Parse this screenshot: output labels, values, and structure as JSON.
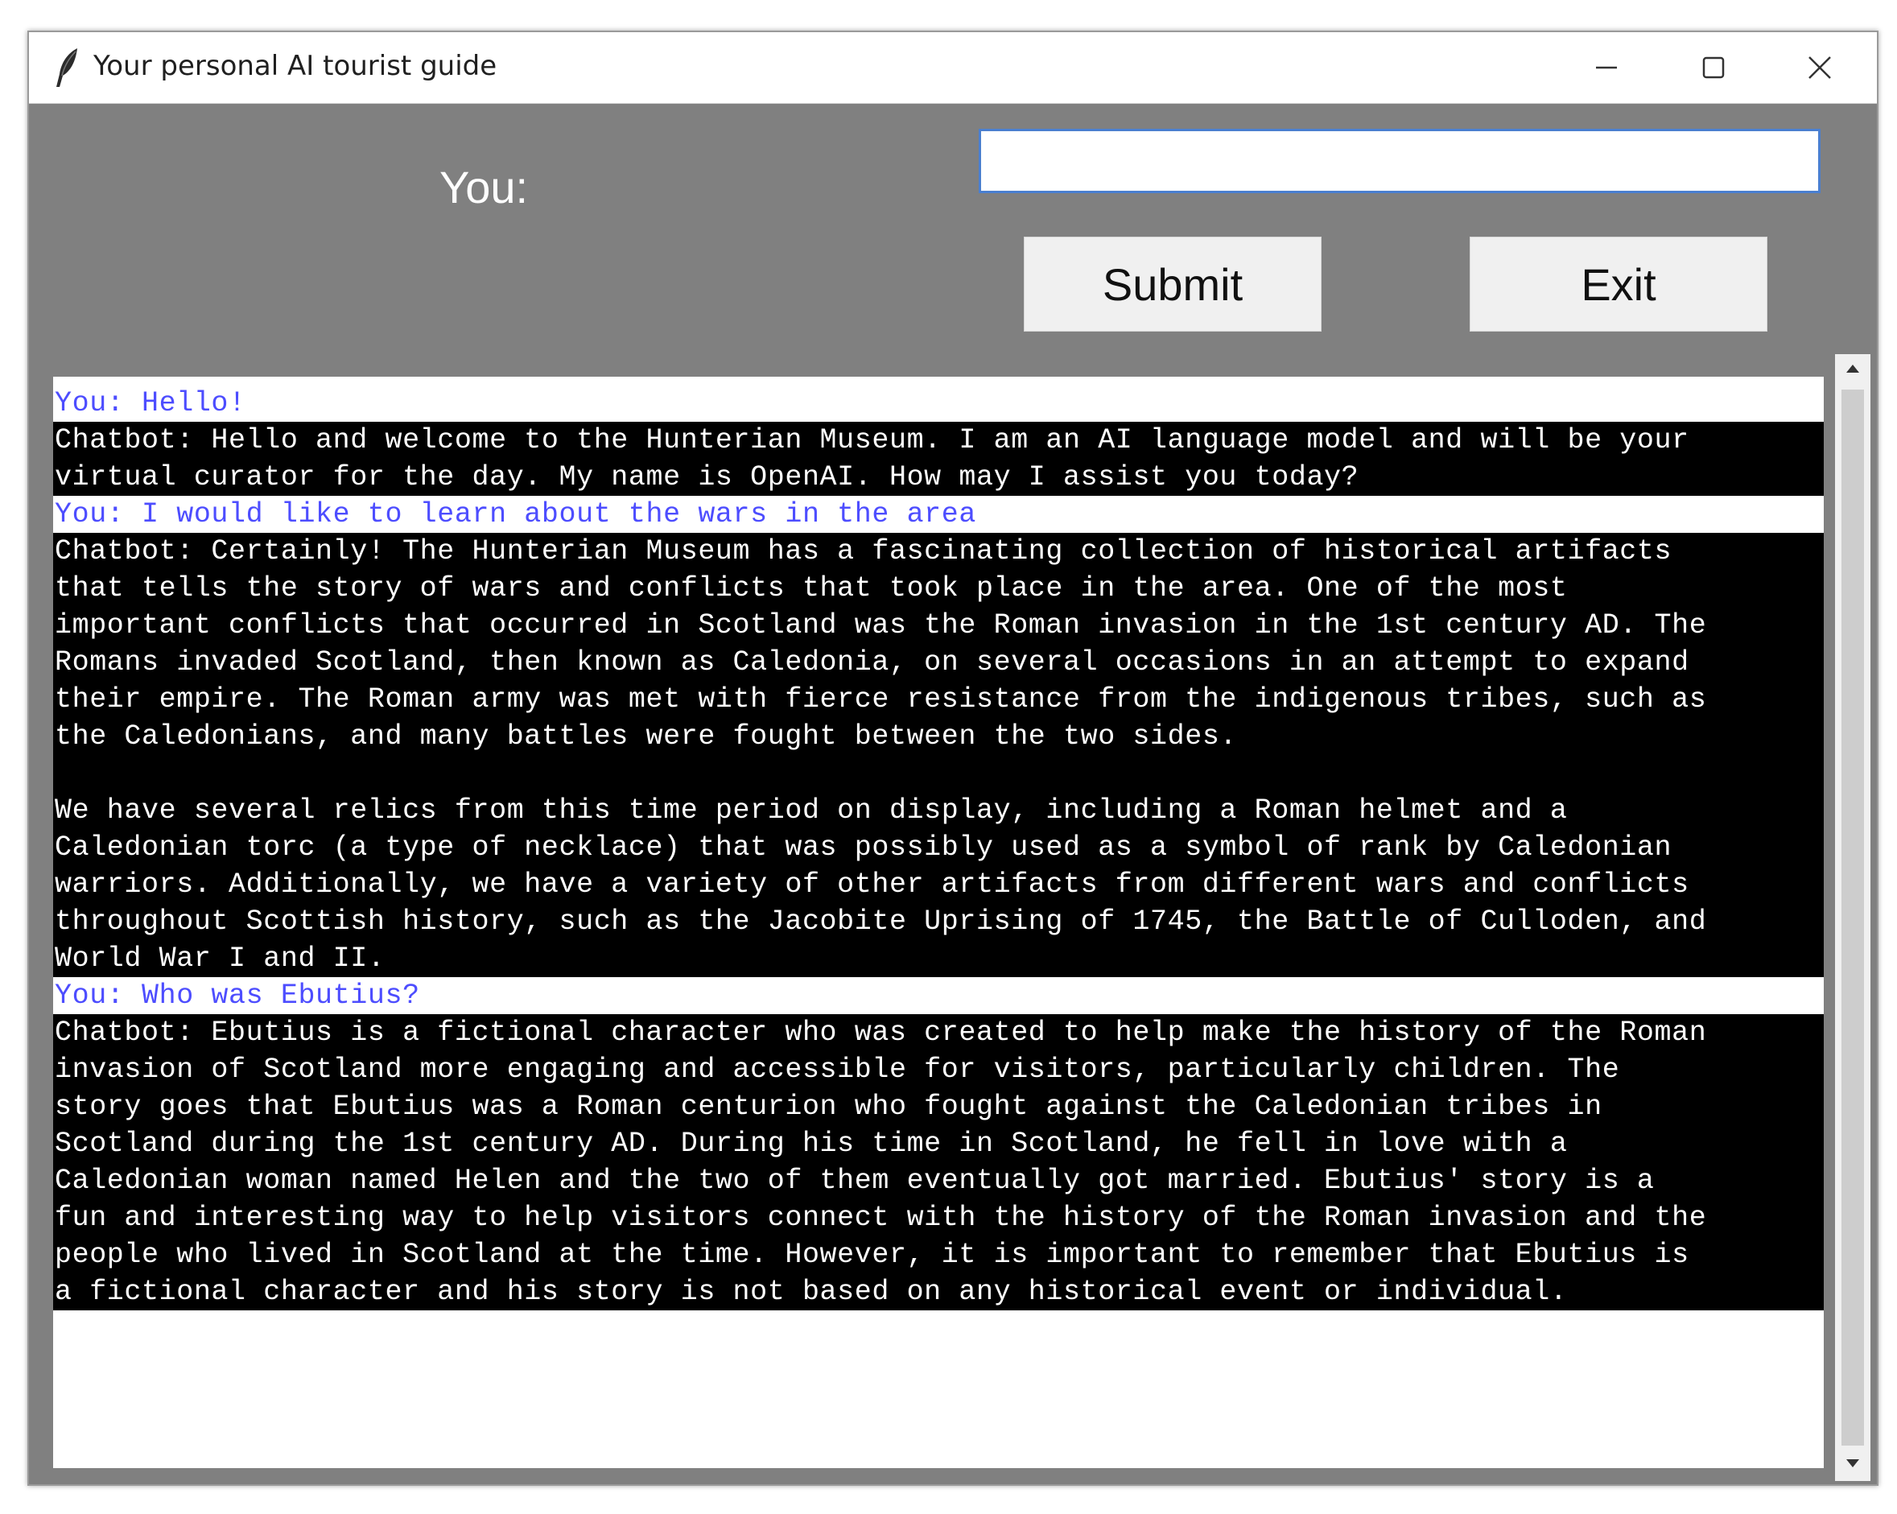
{
  "window": {
    "title": "Your personal AI tourist guide"
  },
  "input": {
    "label": "You:",
    "value": "",
    "placeholder": ""
  },
  "buttons": {
    "submit": "Submit",
    "exit": "Exit"
  },
  "chat": {
    "messages": [
      {
        "role": "user",
        "text": "You: Hello!"
      },
      {
        "role": "bot",
        "text": "Chatbot: Hello and welcome to the Hunterian Museum. I am an AI language model and will be your\nvirtual curator for the day. My name is OpenAI. How may I assist you today?"
      },
      {
        "role": "user",
        "text": "You: I would like to learn about the wars in the area"
      },
      {
        "role": "bot",
        "text": "Chatbot: Certainly! The Hunterian Museum has a fascinating collection of historical artifacts\nthat tells the story of wars and conflicts that took place in the area. One of the most\nimportant conflicts that occurred in Scotland was the Roman invasion in the 1st century AD. The\nRomans invaded Scotland, then known as Caledonia, on several occasions in an attempt to expand\ntheir empire. The Roman army was met with fierce resistance from the indigenous tribes, such as\nthe Caledonians, and many battles were fought between the two sides.\n\nWe have several relics from this time period on display, including a Roman helmet and a\nCaledonian torc (a type of necklace) that was possibly used as a symbol of rank by Caledonian\nwarriors. Additionally, we have a variety of other artifacts from different wars and conflicts\nthroughout Scottish history, such as the Jacobite Uprising of 1745, the Battle of Culloden, and\nWorld War I and II."
      },
      {
        "role": "user",
        "text": "You: Who was Ebutius?"
      },
      {
        "role": "bot",
        "text": "Chatbot: Ebutius is a fictional character who was created to help make the history of the Roman\ninvasion of Scotland more engaging and accessible for visitors, particularly children. The\nstory goes that Ebutius was a Roman centurion who fought against the Caledonian tribes in\nScotland during the 1st century AD. During his time in Scotland, he fell in love with a\nCaledonian woman named Helen and the two of them eventually got married. Ebutius' story is a\nfun and interesting way to help visitors connect with the history of the Roman invasion and the\npeople who lived in Scotland at the time. However, it is important to remember that Ebutius is\na fictional character and his story is not based on any historical event or individual."
      }
    ]
  },
  "colors": {
    "background": "#808080",
    "user_text": "#4d4dff",
    "bot_text": "#ffffff",
    "bot_background": "#000000",
    "input_border": "#4a7fd0",
    "button_face": "#f0f0f0"
  },
  "icons": {
    "app": "feather-icon",
    "minimize": "minimize-icon",
    "maximize": "maximize-icon",
    "close": "close-icon",
    "scroll_up": "arrow-up-icon",
    "scroll_down": "arrow-down-icon"
  }
}
